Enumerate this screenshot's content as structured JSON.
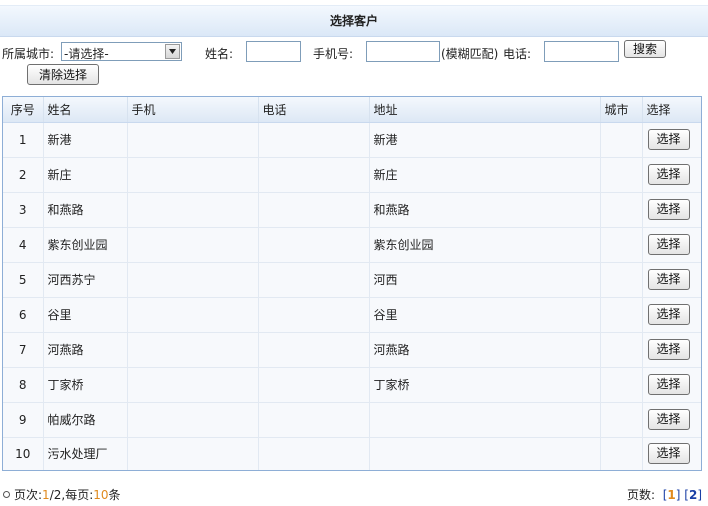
{
  "title": "选择客户",
  "filters": {
    "city_label": "所属城市:",
    "city_selected": "-请选择-",
    "name_label": "姓名:",
    "name_value": "",
    "mobile_label": "手机号:",
    "mobile_value": "",
    "fuzzy_hint": "(模糊匹配)",
    "phone_label": "电话:",
    "phone_value": "",
    "search_button": "搜索",
    "clear_button": "清除选择"
  },
  "table": {
    "headers": [
      "序号",
      "姓名",
      "手机",
      "电话",
      "地址",
      "城市",
      "选择"
    ],
    "select_label": "选择",
    "rows": [
      {
        "no": "1",
        "name": "新港",
        "mobile": "",
        "phone": "",
        "address": "新港",
        "city": ""
      },
      {
        "no": "2",
        "name": "新庄",
        "mobile": "",
        "phone": "",
        "address": "新庄",
        "city": ""
      },
      {
        "no": "3",
        "name": "和燕路",
        "mobile": "",
        "phone": "",
        "address": "和燕路",
        "city": ""
      },
      {
        "no": "4",
        "name": "紫东创业园",
        "mobile": "",
        "phone": "",
        "address": "紫东创业园",
        "city": ""
      },
      {
        "no": "5",
        "name": "河西苏宁",
        "mobile": "",
        "phone": "",
        "address": "河西",
        "city": ""
      },
      {
        "no": "6",
        "name": "谷里",
        "mobile": "",
        "phone": "",
        "address": "谷里",
        "city": ""
      },
      {
        "no": "7",
        "name": "河燕路",
        "mobile": "",
        "phone": "",
        "address": "河燕路",
        "city": ""
      },
      {
        "no": "8",
        "name": "丁家桥",
        "mobile": "",
        "phone": "",
        "address": "丁家桥",
        "city": ""
      },
      {
        "no": "9",
        "name": "帕威尔路",
        "mobile": "",
        "phone": "",
        "address": "",
        "city": ""
      },
      {
        "no": "10",
        "name": "污水处理厂",
        "mobile": "",
        "phone": "",
        "address": "",
        "city": ""
      }
    ]
  },
  "pagination": {
    "page_label": "页次:",
    "page_current": "1",
    "page_sep": "/2",
    "per_page_label": ",每页:",
    "per_page": "10",
    "per_page_unit": "条",
    "pages_label": "页数:",
    "pages": [
      "1",
      "2"
    ]
  },
  "colors": {
    "accent_orange": "#e08a1e",
    "link_blue": "#1a3fa6",
    "header_blue": "#dbe8f7"
  }
}
